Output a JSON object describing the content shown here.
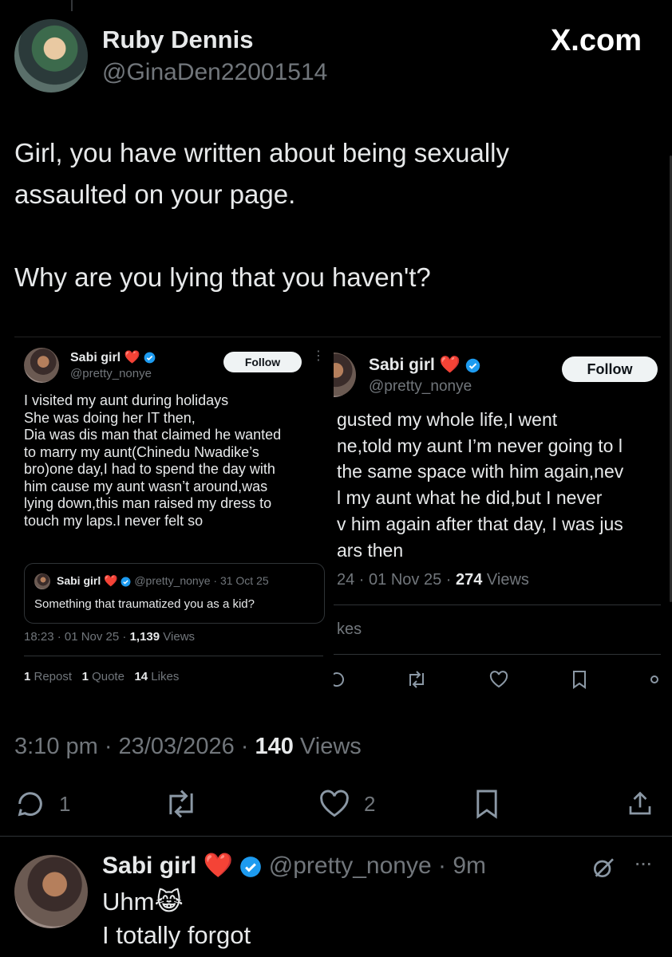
{
  "main_tweet": {
    "author_name": "Ruby Dennis",
    "author_handle": "@GinaDen22001514",
    "brand": "X.com",
    "text_line1": "Girl, you have written about being sexually",
    "text_line2": "assaulted on your page.",
    "text_line3": "Why are you lying that you haven't?",
    "time": "3:10 pm · 23/03/2026 · ",
    "views_count": "140",
    "views_label": " Views",
    "replies": "1",
    "likes": "2"
  },
  "screenshot_left": {
    "author_name": "Sabi girl",
    "author_handle": "@pretty_nonye",
    "follow_label": "Follow",
    "lines": [
      "I visited my aunt during holidays",
      "She was doing her IT then,",
      "Dia was dis man that claimed he wanted",
      "to marry my aunt(Chinedu Nwadike’s",
      "bro)one day,I had to spend the day with",
      "him cause my aunt wasn’t around,was",
      "lying down,this man raised my dress to",
      "touch my laps.I never felt so"
    ],
    "quoted_name": "Sabi girl",
    "quoted_meta": "@pretty_nonye · 31 Oct 25",
    "quoted_text": "Something that traumatized you as a kid?",
    "time": "18:23 · 01 Nov 25 · ",
    "views_count": "1,139",
    "views_label": " Views",
    "reposts_count": "1",
    "reposts_label": " Repost",
    "quotes_count": "1",
    "quotes_label": " Quote",
    "likes_count": "14",
    "likes_label": " Likes"
  },
  "screenshot_right": {
    "author_name": "Sabi girl",
    "author_handle": "@pretty_nonye",
    "follow_label": "Follow",
    "lines": [
      "gusted my whole life,I went",
      "ne,told my aunt I’m never going to l",
      "the same space with him again,nev",
      "l my aunt what he did,but I never",
      "v him again after that day, I was jus",
      "ars then"
    ],
    "time": "24 · 01 Nov 25 · ",
    "views_count": "274",
    "views_label": " Views",
    "likes_fragment": "kes"
  },
  "reply": {
    "author_name": "Sabi girl",
    "author_handle": "@pretty_nonye",
    "age": "· 9m",
    "line1": "Uhm",
    "line1_emoji": "😹",
    "line2": "I totally forgot"
  },
  "colors": {
    "background": "#000000",
    "text": "#e7e9ea",
    "muted": "#71767b",
    "verified_blue": "#1d9bf0",
    "heart_red": "#f4212e"
  }
}
